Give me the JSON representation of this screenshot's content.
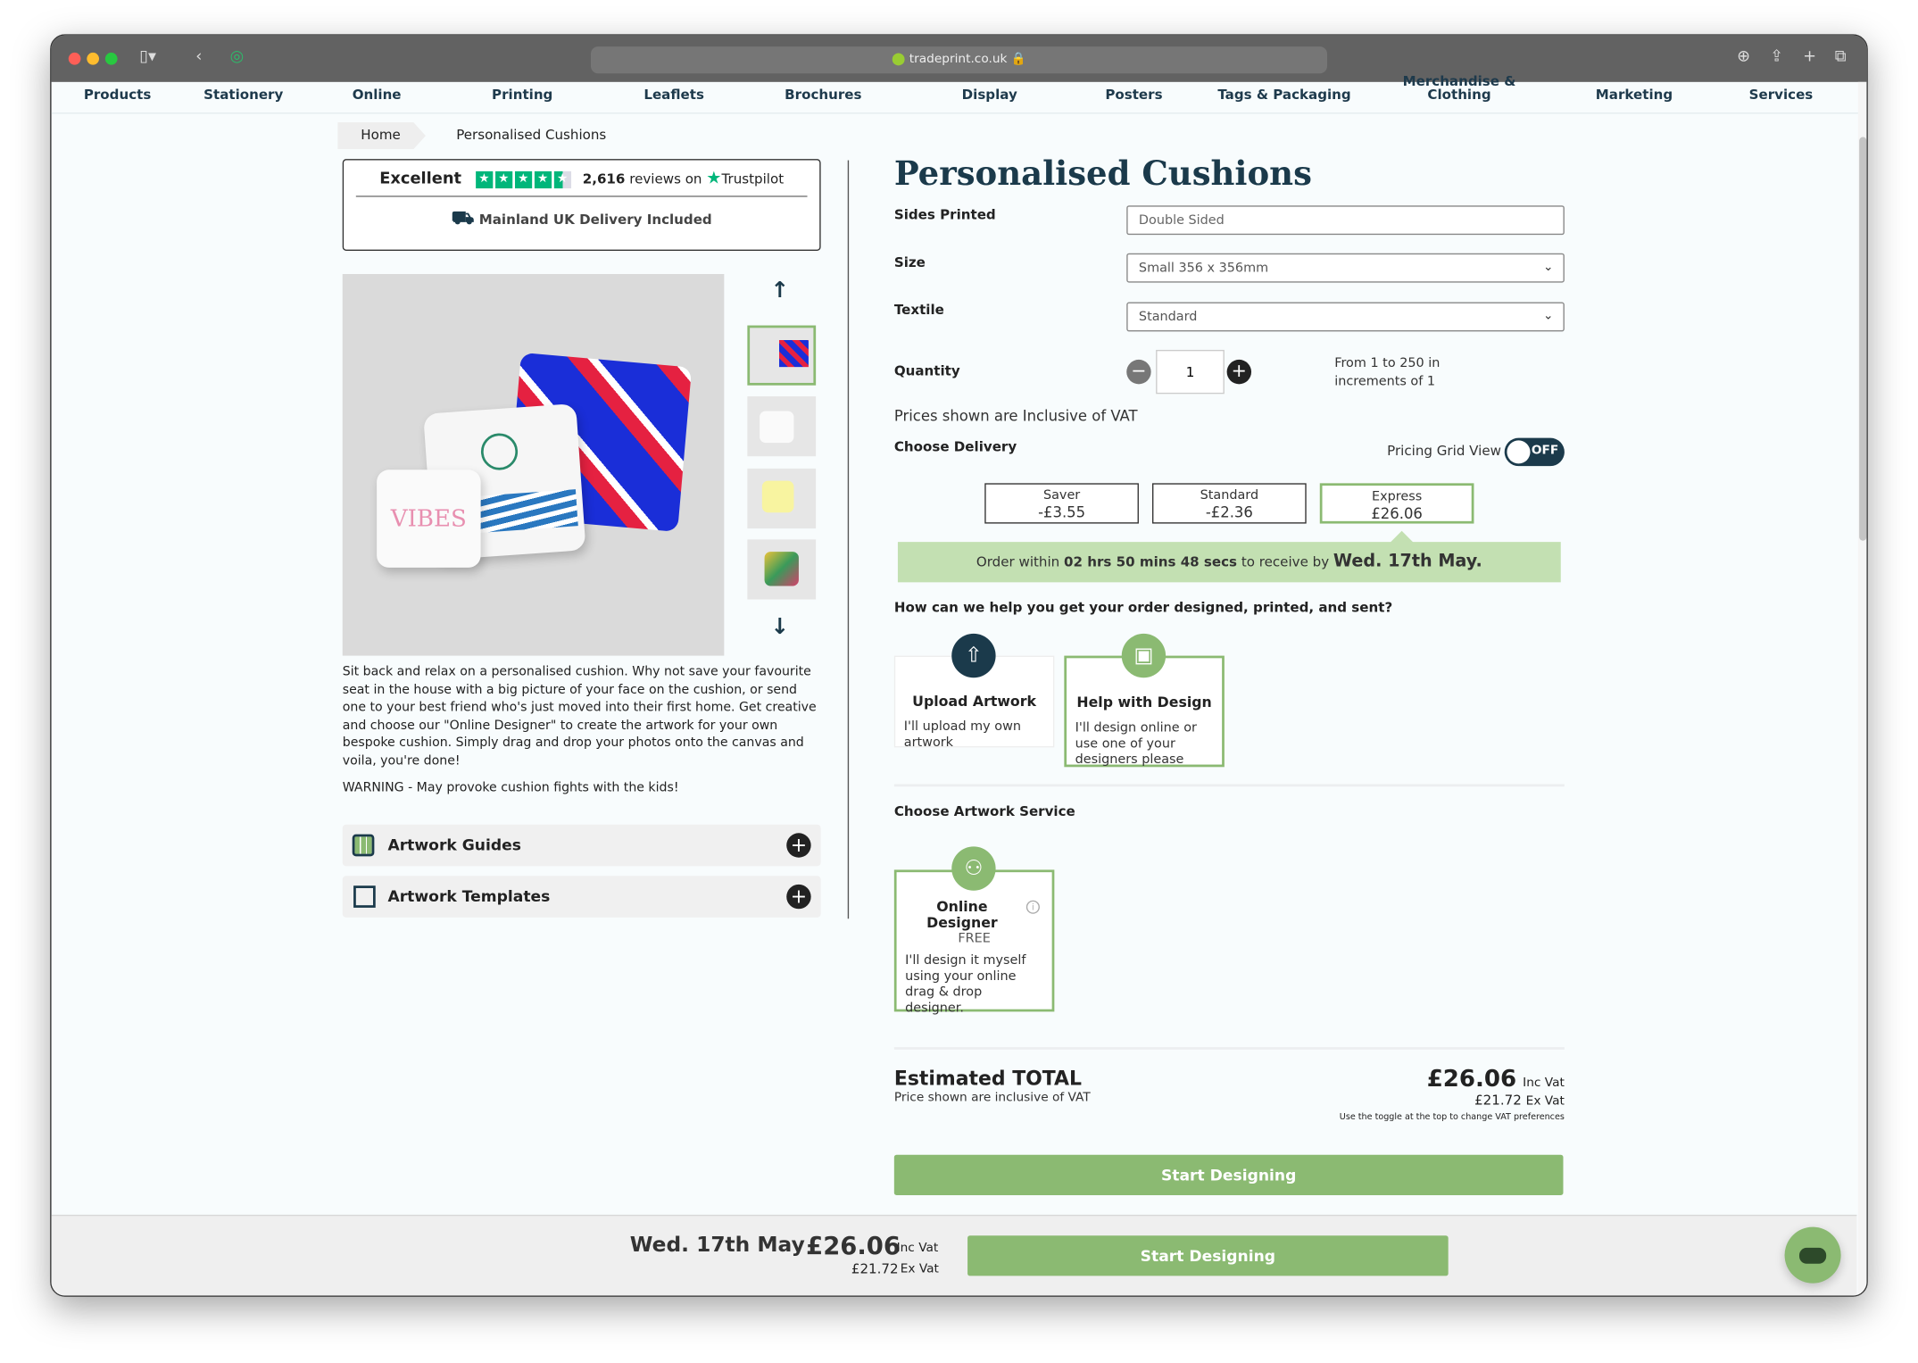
{
  "browser": {
    "url": "tradeprint.co.uk"
  },
  "nav": [
    "Products",
    "Stationery",
    "Online",
    "Printing",
    "Leaflets",
    "Brochures",
    "Display",
    "Posters",
    "Tags & Packaging",
    "Merchandise & Clothing",
    "Marketing",
    "Services"
  ],
  "breadcrumb": {
    "home": "Home",
    "current": "Personalised Cushions"
  },
  "trustpilot": {
    "rating_label": "Excellent",
    "stars": 4.5,
    "reviews": "2,616",
    "reviews_suffix": "reviews on",
    "brand": "Trustpilot",
    "delivery": "Mainland UK Delivery Included"
  },
  "product": {
    "description": "Sit back and relax on a personalised cushion. Why not save your favourite seat in the house with a big picture of your face on the cushion, or send one to your best friend who's just moved into their first home. Get creative and choose our \"Online Designer\" to create the artwork for your own bespoke cushion. Simply drag and drop your photos onto the canvas and voila, you're done!",
    "warning": "WARNING - May provoke cushion fights with the kids!",
    "image_text": "VIBES",
    "accordions": [
      "Artwork Guides",
      "Artwork Templates"
    ]
  },
  "config": {
    "title": "Personalised Cushions",
    "sides": {
      "label": "Sides Printed",
      "value": "Double Sided"
    },
    "size": {
      "label": "Size",
      "value": "Small 356 x 356mm"
    },
    "textile": {
      "label": "Textile",
      "value": "Standard"
    },
    "quantity": {
      "label": "Quantity",
      "value": "1",
      "note_line1": "From 1 to 250 in",
      "note_line2": "increments of 1"
    },
    "vat_note": "Prices shown are Inclusive of VAT",
    "delivery_label": "Choose Delivery",
    "pricing_grid": {
      "label": "Pricing Grid View",
      "state": "OFF"
    },
    "delivery_options": [
      {
        "name": "Saver",
        "price": "-£3.55"
      },
      {
        "name": "Standard",
        "price": "-£2.36"
      },
      {
        "name": "Express",
        "price": "£26.06",
        "selected": true
      }
    ],
    "banner": {
      "prefix": "Order within",
      "countdown": "02 hrs 50 mins 48 secs",
      "middle": "to receive by",
      "date": "Wed. 17th May."
    },
    "help_question": "How can we help you get your order designed, printed, and sent?",
    "help_options": [
      {
        "title": "Upload Artwork",
        "text": "I'll upload my own artwork"
      },
      {
        "title": "Help with Design",
        "text": "I'll design online or use one of your designers please",
        "selected": true
      }
    ],
    "artwork_service_label": "Choose Artwork Service",
    "artwork_service": {
      "title": "Online Designer",
      "price": "FREE",
      "text": "I'll design it myself using your online drag & drop designer."
    },
    "total": {
      "label": "Estimated TOTAL",
      "sub": "Price shown are inclusive of VAT",
      "inc": "£26.06",
      "inc_label": "Inc Vat",
      "ex": "£21.72",
      "ex_label": "Ex Vat",
      "toggle_note": "Use the toggle at the top to change VAT preferences"
    },
    "cta": "Start Designing"
  },
  "bottom_bar": {
    "date": "Wed. 17th May",
    "price": "£26.06",
    "inc_label": "Inc Vat",
    "ex": "£21.72",
    "ex_label": "Ex Vat",
    "cta": "Start Designing"
  },
  "colors": {
    "brand_green": "#8bba72",
    "banner_green": "#c3e0b2",
    "navy": "#1b3a4b"
  }
}
